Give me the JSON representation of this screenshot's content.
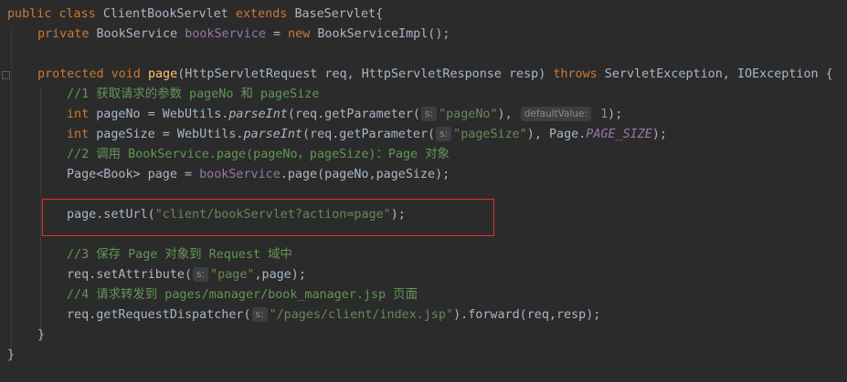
{
  "code": {
    "l1": {
      "kw1": "public ",
      "kw2": "class ",
      "cls": "ClientBookServlet ",
      "kw3": "extends ",
      "base": "BaseServlet{"
    },
    "l2": {
      "kw1": "private ",
      "type": "BookService ",
      "field": "bookService",
      "eq": " = ",
      "kw2": "new ",
      "ctor": "BookServiceImpl();"
    },
    "l3": {
      "kw1": "protected ",
      "kw2": "void ",
      "method": "page",
      "params1": "(HttpServletRequest req, HttpServletResponse resp) ",
      "kw3": "throws ",
      "params2": "ServletException, IOException {"
    },
    "l4": {
      "comment": "//1 获取请求的参数 pageNo 和 pageSize"
    },
    "l5": {
      "kw": "int ",
      "pre": "pageNo = WebUtils.",
      "call": "parseInt",
      "mid": "(req.getParameter(",
      "hint1": "s:",
      "str": "\"pageNo\"",
      "comma": "), ",
      "hint2": "defaultValue:",
      "num": " 1",
      "end": ");"
    },
    "l6": {
      "kw": "int ",
      "pre": "pageSize = WebUtils.",
      "call": "parseInt",
      "mid": "(req.getParameter(",
      "hint1": "s:",
      "str": "\"pageSize\"",
      "mid2": "), Page.",
      "const": "PAGE_SIZE",
      "end": ");"
    },
    "l7": {
      "comment": "//2 调用 BookService.page(pageNo，pageSize)：Page 对象"
    },
    "l8": {
      "pre": "Page<Book> page = ",
      "field": "bookService",
      "end": ".page(pageNo,pageSize);"
    },
    "l9": {
      "pre": "page.setUrl(",
      "str": "\"client/bookServlet?action=page\"",
      "end": ");"
    },
    "l10": {
      "comment": "//3 保存 Page 对象到 Request 域中"
    },
    "l11": {
      "pre": "req.setAttribute(",
      "hint": "s:",
      "str": "\"page\"",
      "end": ",page);"
    },
    "l12": {
      "comment": "//4 请求转发到 pages/manager/book_manager.jsp 页面"
    },
    "l13": {
      "pre": "req.getRequestDispatcher(",
      "hint": "s:",
      "str": "\"/pages/client/index.jsp\"",
      "end": ").forward(req,resp);"
    },
    "l14": {
      "text": "}"
    },
    "l15": {
      "text": "}"
    }
  },
  "colors": {
    "background": "#2b2b2b",
    "keyword": "#cc7832",
    "field": "#9876aa",
    "method": "#ffc66d",
    "comment": "#629755",
    "string": "#6a8759",
    "number": "#6897bb",
    "default": "#a9b7c6",
    "highlight_border": "#e3342f"
  }
}
